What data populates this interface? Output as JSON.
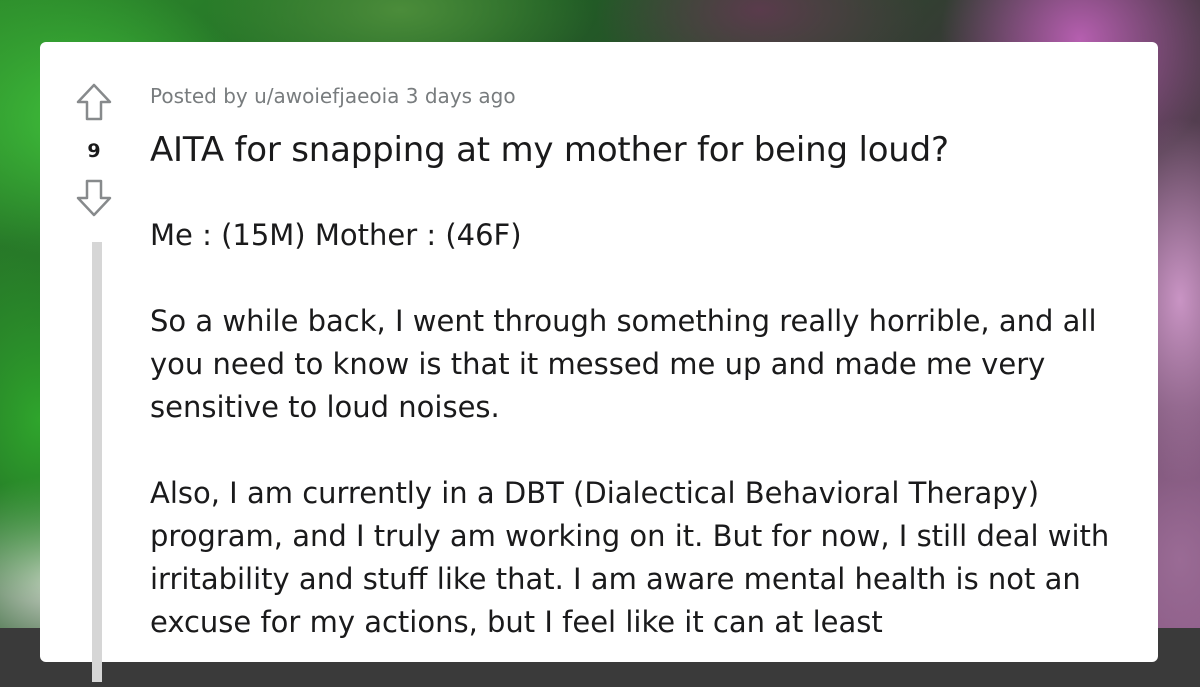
{
  "post": {
    "posted_by": "Posted by u/awoiefjaeoia 3 days ago",
    "score": "9",
    "title": "AITA for snapping at my mother for being loud?",
    "paragraphs": [
      "Me : (15M) Mother : (46F)",
      "So a while back, I went through something really horrible, and all you need to know is that it messed me up and made me very sensitive to loud noises.",
      "Also, I am currently in a DBT (Dialectical Behavioral Therapy) program, and I truly am working on it. But for now, I still deal with irritability and stuff like that. I am aware mental health is not an excuse for my actions, but I feel like it can at least"
    ]
  },
  "icons": {
    "upvote": "arrow-up-outline-icon",
    "downvote": "arrow-down-outline-icon"
  },
  "colors": {
    "text": "#1a1a1b",
    "meta": "#787c7e",
    "icon": "#878a8c",
    "thread_line": "#d6d6d6"
  }
}
